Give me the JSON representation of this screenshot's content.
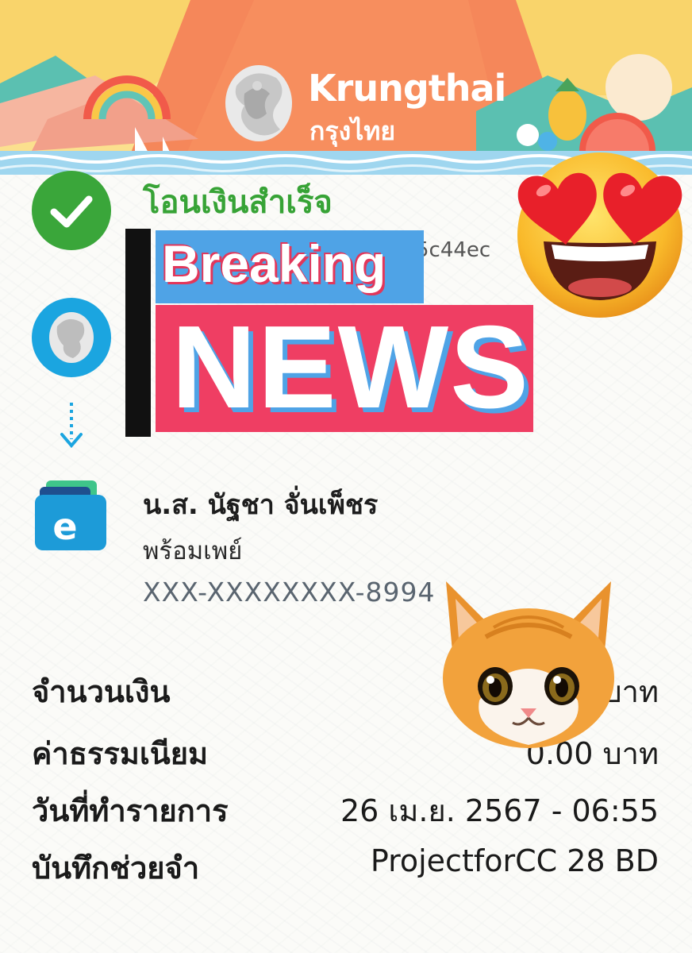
{
  "header": {
    "brand_name": "Krungthai",
    "brand_thai": "กรุงไทย"
  },
  "status": {
    "title": "โอนเงินสำเร็จ",
    "reference_partial": "5c44ec"
  },
  "receiver": {
    "name": "น.ส. นัฐชา จั่นเพ็ชร",
    "bank": "พร้อมเพย์",
    "account": "XXX-XXXXXXXX-8994"
  },
  "details": [
    {
      "label": "จำนวนเงิน",
      "value": "บาท"
    },
    {
      "label": "ค่าธรรมเนียม",
      "value": "0.00 บาท"
    },
    {
      "label": "วันที่ทำรายการ",
      "value": "26 เม.ย. 2567 - 06:55"
    },
    {
      "label": "บันทึกช่วยจำ",
      "value": "ProjectforCC 28 BD"
    }
  ],
  "overlay": {
    "breaking": "Breaking",
    "news": "NEWS"
  },
  "colors": {
    "success_green": "#37a336",
    "krungthai_blue": "#1ba5e0",
    "banner_orange": "#f28a5c",
    "breaking_blue": "#4fa3e6",
    "news_pink": "#ef3e63"
  },
  "icons": {
    "success": "check-circle-icon",
    "sender_bank": "krungthai-logo-icon",
    "arrow": "arrow-down-icon",
    "receiver_wallet": "e-wallet-icon",
    "sticker_1": "heart-eyes-emoji",
    "sticker_2": "cat-face-sticker"
  }
}
